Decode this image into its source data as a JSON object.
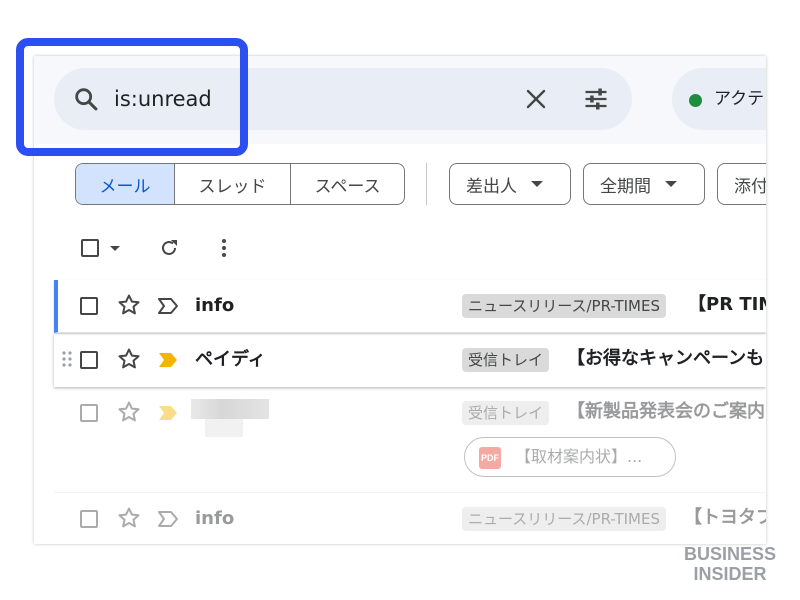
{
  "search": {
    "query": "is:unread",
    "icon": "search-icon",
    "clear_icon": "close-icon",
    "options_icon": "tune-icon"
  },
  "status": {
    "label": "アクテ",
    "dot_color": "#1e8e3e"
  },
  "scope_tabs": [
    "メール",
    "スレッド",
    "スペース"
  ],
  "filters": [
    "差出人",
    "全期間",
    "添付"
  ],
  "toolbar": {
    "select_icon": "checkbox-icon",
    "refresh_icon": "refresh-icon",
    "more_icon": "more-vert-icon"
  },
  "emails": [
    {
      "sender": "info",
      "label": "ニュースリリース/PR-TIMES",
      "subject": "【PR TIME",
      "important_color": "#444746"
    },
    {
      "sender": "ペイディ",
      "label": "受信トレイ",
      "subject": "【お得なキャンペーンも",
      "important_color": "#f5b400"
    },
    {
      "sender": "",
      "label": "受信トレイ",
      "subject": "【新製品発表会のご案内",
      "attachment": "【取材案内状】...",
      "important_color": "#f5b400"
    },
    {
      "sender": "info",
      "label": "ニュースリリース/PR-TIMES",
      "subject": "【トヨタブ",
      "important_color": "#444746"
    }
  ],
  "colors": {
    "accent": "#0b57d0",
    "highlight": "#2b4ff0",
    "unread_bar": "#4285f4"
  },
  "watermark": {
    "line1": "BUSINESS",
    "line2": "INSIDER"
  }
}
